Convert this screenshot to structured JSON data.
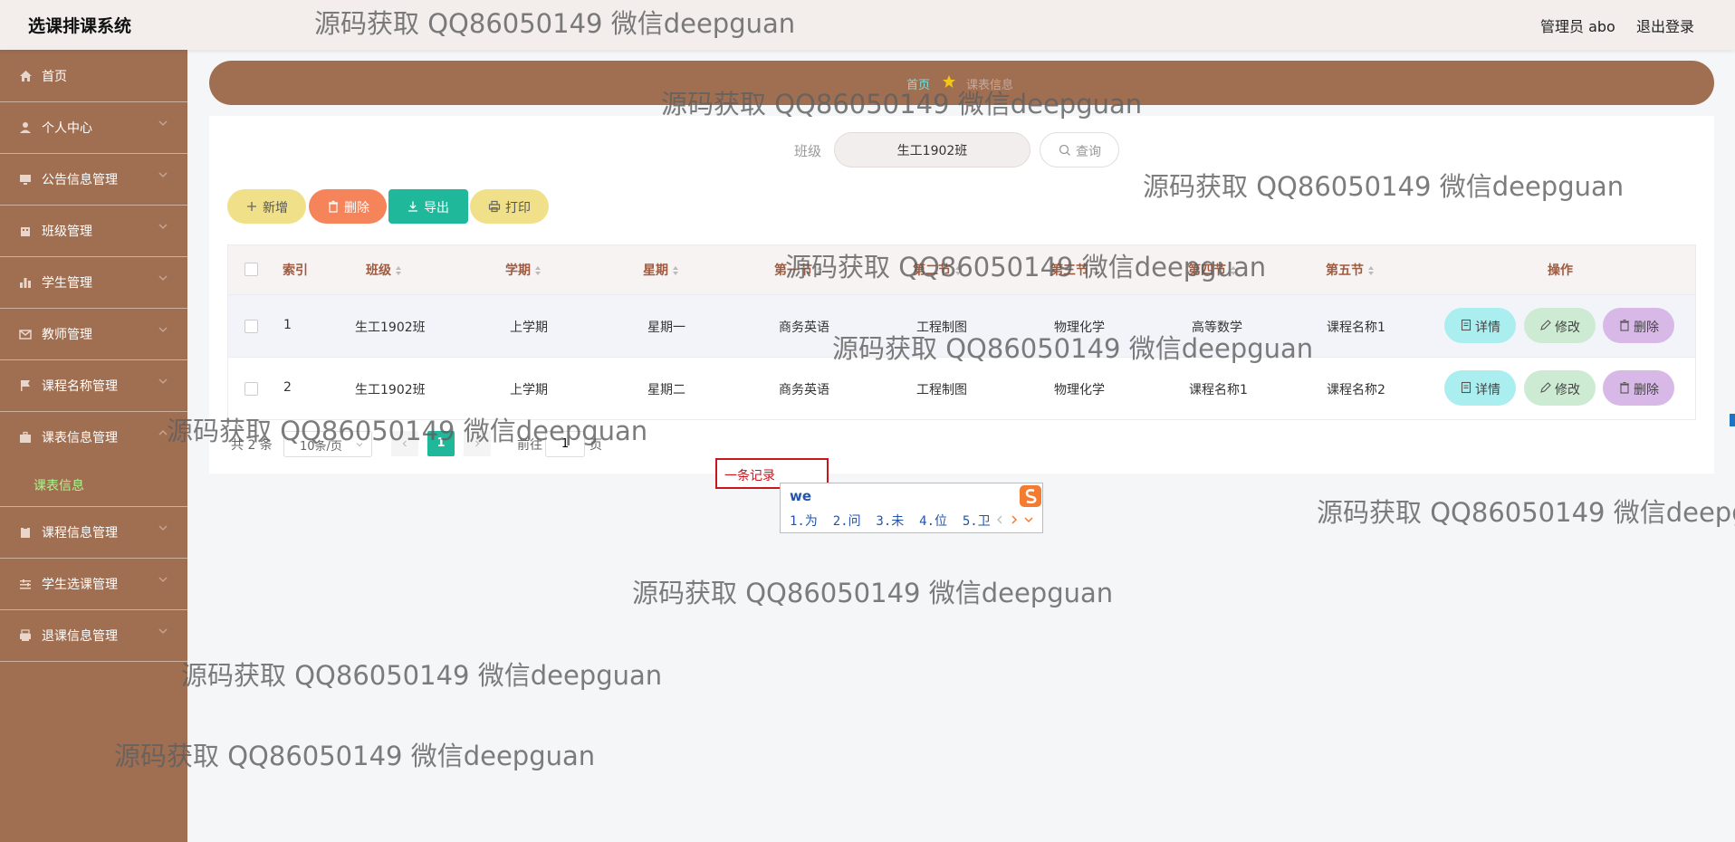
{
  "app_title": "选课排课系统",
  "header": {
    "admin_label": "管理员 abo",
    "logout_label": "退出登录"
  },
  "sidebar": {
    "items": [
      {
        "label": "首页",
        "icon": "home-icon",
        "chevron": false
      },
      {
        "label": "个人中心",
        "icon": "user-icon",
        "chevron": true
      },
      {
        "label": "公告信息管理",
        "icon": "monitor-icon",
        "chevron": true
      },
      {
        "label": "班级管理",
        "icon": "building-icon",
        "chevron": true
      },
      {
        "label": "学生管理",
        "icon": "bar-chart-icon",
        "chevron": true
      },
      {
        "label": "教师管理",
        "icon": "mail-icon",
        "chevron": true
      },
      {
        "label": "课程名称管理",
        "icon": "flag-icon",
        "chevron": true
      },
      {
        "label": "课表信息管理",
        "icon": "briefcase-icon",
        "chevron": true
      },
      {
        "label": "课程信息管理",
        "icon": "clipboard-icon",
        "chevron": true
      },
      {
        "label": "学生选课管理",
        "icon": "sliders-icon",
        "chevron": true
      },
      {
        "label": "退课信息管理",
        "icon": "printer-icon",
        "chevron": true
      }
    ],
    "submenu": {
      "label": "课表信息",
      "color": "#b5f090"
    }
  },
  "breadcrumb": {
    "home": "首页",
    "current": "课表信息"
  },
  "search": {
    "label": "班级",
    "value": "生工1902班",
    "button_label": "查询"
  },
  "toolbar": {
    "add_label": "新增",
    "delete_label": "删除",
    "export_label": "导出",
    "print_label": "打印"
  },
  "table": {
    "headers": [
      "索引",
      "班级",
      "学期",
      "星期",
      "第一节",
      "第二节",
      "第三节",
      "第四节",
      "第五节",
      "操作"
    ],
    "rows": [
      [
        "1",
        "生工1902班",
        "上学期",
        "星期一",
        "商务英语",
        "工程制图",
        "物理化学",
        "高等数学",
        "课程名称1"
      ],
      [
        "2",
        "生工1902班",
        "上学期",
        "星期二",
        "商务英语",
        "工程制图",
        "物理化学",
        "课程名称1",
        "课程名称2"
      ]
    ],
    "row_actions": {
      "detail": "详情",
      "edit": "修改",
      "delete": "删除"
    }
  },
  "pagination": {
    "total": "共 2 条",
    "page_size": "10条/页",
    "current_page": "1",
    "goto_label": "前往",
    "goto_value": "1",
    "page_unit": "页"
  },
  "edit_overlay": {
    "text": "一条记录"
  },
  "ime": {
    "composition": "we",
    "candidates": "1.为  2.问  3.未  4.位  5.卫"
  },
  "watermark": "源码获取 QQ86050149 微信deepguan",
  "colors": {
    "sidebar": "#a06f52",
    "topbar": "#f3eeec",
    "accent_green": "#1fb89a",
    "btn_yellow": "#f1e08a",
    "btn_orange": "#f5845b",
    "btn_cyan": "#aaeef0",
    "btn_green": "#cdebd3",
    "btn_purple": "#d7b8e6",
    "overlay_red": "#c8161d"
  }
}
